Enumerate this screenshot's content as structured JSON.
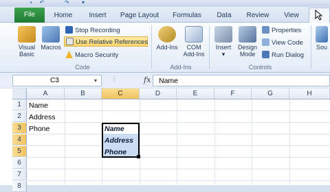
{
  "tabs": {
    "file": "File",
    "home": "Home",
    "insert": "Insert",
    "page_layout": "Page Layout",
    "formulas": "Formulas",
    "data": "Data",
    "review": "Review",
    "view": "View"
  },
  "ribbon": {
    "code": {
      "visual_basic_line1": "Visual",
      "visual_basic_line2": "Basic",
      "macros": "Macros",
      "stop_recording": "Stop Recording",
      "use_relative_references": "Use Relative References",
      "macro_security": "Macro Security",
      "group_label": "Code"
    },
    "addins": {
      "add_ins": "Add-Ins",
      "com_line1": "COM",
      "com_line2": "Add-Ins",
      "group_label": "Add-Ins"
    },
    "controls": {
      "insert": "Insert",
      "design_line1": "Design",
      "design_line2": "Mode",
      "properties": "Properties",
      "view_code": "View Code",
      "run_dialog": "Run Dialog",
      "group_label": "Controls"
    },
    "source_partial": "Sou"
  },
  "formula_bar": {
    "name_box": "C3",
    "fx": "fx",
    "content": "Name"
  },
  "grid": {
    "columns": [
      "A",
      "B",
      "C",
      "D",
      "E",
      "F",
      "G",
      "H"
    ],
    "rows": [
      "1",
      "2",
      "3",
      "4",
      "5",
      "6",
      "7",
      "8"
    ],
    "cells": {
      "A1": "Name",
      "A2": "Address",
      "A3": "Phone",
      "C3": "Name",
      "C4": "Address",
      "C5": "Phone"
    }
  }
}
